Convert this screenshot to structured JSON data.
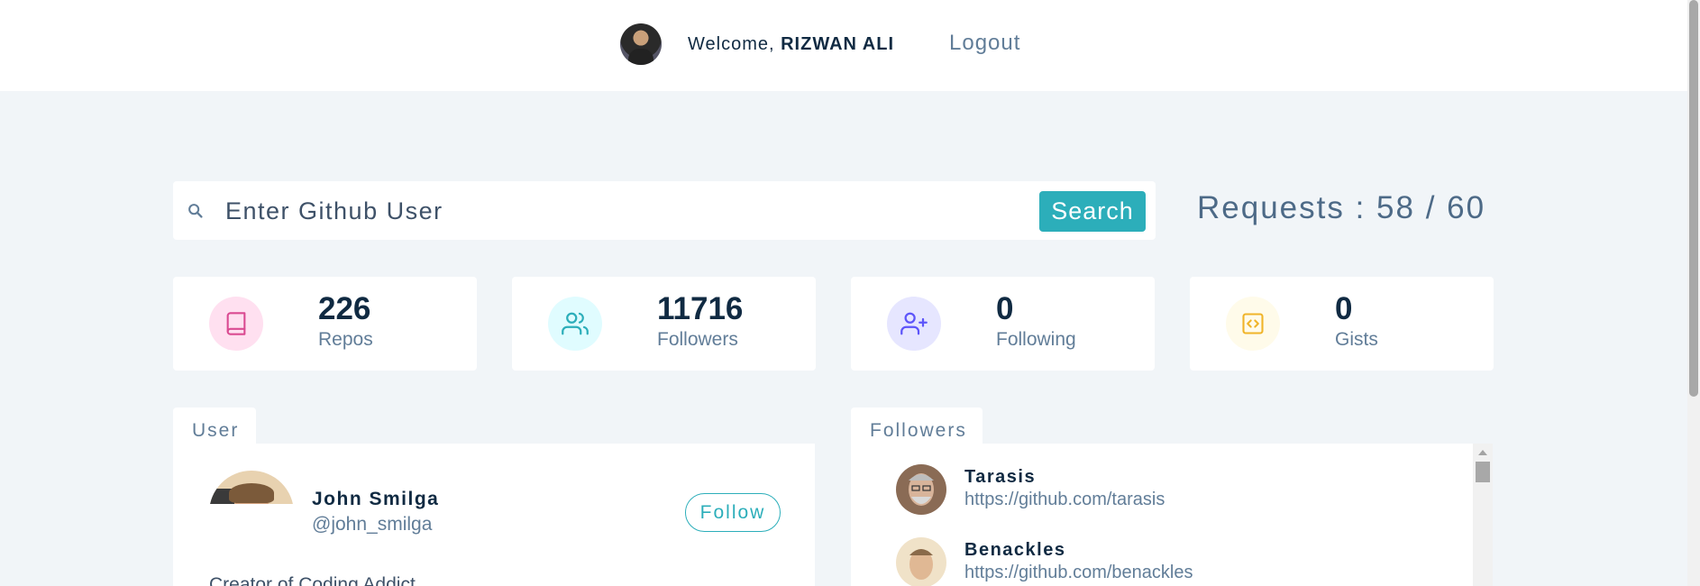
{
  "nav": {
    "welcome_prefix": "Welcome,",
    "user_name": "RIZWAN ALI",
    "logout_label": "Logout"
  },
  "search": {
    "placeholder": "Enter Github User",
    "button_label": "Search",
    "requests_text": "Requests : 58 / 60"
  },
  "stats": [
    {
      "value": "226",
      "label": "Repos",
      "icon": "book-icon",
      "color": "#da4a91",
      "bg": "#ffe0f0"
    },
    {
      "value": "11716",
      "label": "Followers",
      "icon": "users-icon",
      "color": "#2caeba",
      "bg": "#e0fcff"
    },
    {
      "value": "0",
      "label": "Following",
      "icon": "user-plus-icon",
      "color": "#5d55fa",
      "bg": "#e6e6ff"
    },
    {
      "value": "0",
      "label": "Gists",
      "icon": "code-icon",
      "color": "#f0b429",
      "bg": "#fffbea"
    }
  ],
  "user_section": {
    "tab_label": "User",
    "name": "John Smilga",
    "handle": "@john_smilga",
    "follow_label": "Follow",
    "bio": "Creator of Coding Addict"
  },
  "followers_section": {
    "tab_label": "Followers",
    "items": [
      {
        "name": "Tarasis",
        "url": "https://github.com/tarasis"
      },
      {
        "name": "Benackles",
        "url": "https://github.com/benackles"
      }
    ]
  }
}
